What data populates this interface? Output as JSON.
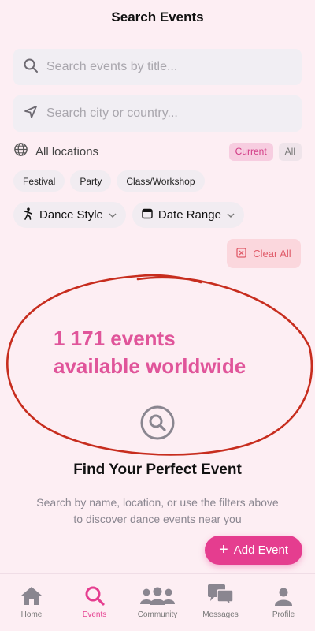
{
  "header": {
    "title": "Search Events"
  },
  "search": {
    "title_placeholder": "Search events by title...",
    "title_value": "",
    "city_placeholder": "Search city or country...",
    "city_value": ""
  },
  "locations": {
    "label": "All locations",
    "scope_options": [
      "Current",
      "All"
    ],
    "scope_selected": "Current"
  },
  "categories": [
    "Festival",
    "Party",
    "Class/Workshop"
  ],
  "filters": {
    "dance_style_label": "Dance Style",
    "date_range_label": "Date Range",
    "clear_all_label": "Clear All"
  },
  "annotation": {
    "text_line1": "1 171 events",
    "text_line2": "available worldwide",
    "color": "#e0559a",
    "circle_color": "#c72d1e"
  },
  "empty_state": {
    "icon": "search-icon",
    "title": "Find Your Perfect Event",
    "description": "Search by name, location, or use the filters above to discover dance events near you"
  },
  "add_event": {
    "label": "Add Event"
  },
  "tabbar": {
    "items": [
      {
        "label": "Home",
        "icon": "home-icon",
        "active": false
      },
      {
        "label": "Events",
        "icon": "search-icon",
        "active": true
      },
      {
        "label": "Community",
        "icon": "community-icon",
        "active": false
      },
      {
        "label": "Messages",
        "icon": "messages-icon",
        "active": false
      },
      {
        "label": "Profile",
        "icon": "profile-icon",
        "active": false
      }
    ]
  },
  "colors": {
    "accent": "#e53d8f",
    "background": "#fdeef3",
    "clear_button": "#fbd7dd",
    "clear_text": "#e05c6a"
  }
}
